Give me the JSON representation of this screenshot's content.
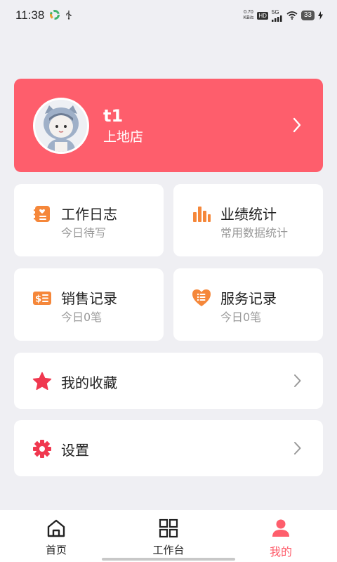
{
  "status_bar": {
    "time": "11:38",
    "net_speed_value": "0.70",
    "net_speed_unit": "KB/s",
    "hd": "HD",
    "network": "5G",
    "battery": "33"
  },
  "profile": {
    "name": "t1",
    "store": "上地店",
    "accent_color": "#fe5e6c"
  },
  "tiles": [
    {
      "title": "工作日志",
      "subtitle": "今日待写",
      "icon": "notebook-icon"
    },
    {
      "title": "业绩统计",
      "subtitle": "常用数据统计",
      "icon": "bar-chart-icon"
    },
    {
      "title": "销售记录",
      "subtitle": "今日0笔",
      "icon": "receipt-icon"
    },
    {
      "title": "服务记录",
      "subtitle": "今日0笔",
      "icon": "heart-list-icon"
    }
  ],
  "rows": [
    {
      "label": "我的收藏",
      "icon": "star-icon"
    },
    {
      "label": "设置",
      "icon": "gear-icon"
    }
  ],
  "nav": [
    {
      "label": "首页",
      "icon": "home-icon"
    },
    {
      "label": "工作台",
      "icon": "grid-icon"
    },
    {
      "label": "我的",
      "icon": "user-icon",
      "active": true
    }
  ],
  "colors": {
    "accent": "#fe5e6c",
    "icon_orange": "#f5873a",
    "icon_red": "#f0384f"
  }
}
